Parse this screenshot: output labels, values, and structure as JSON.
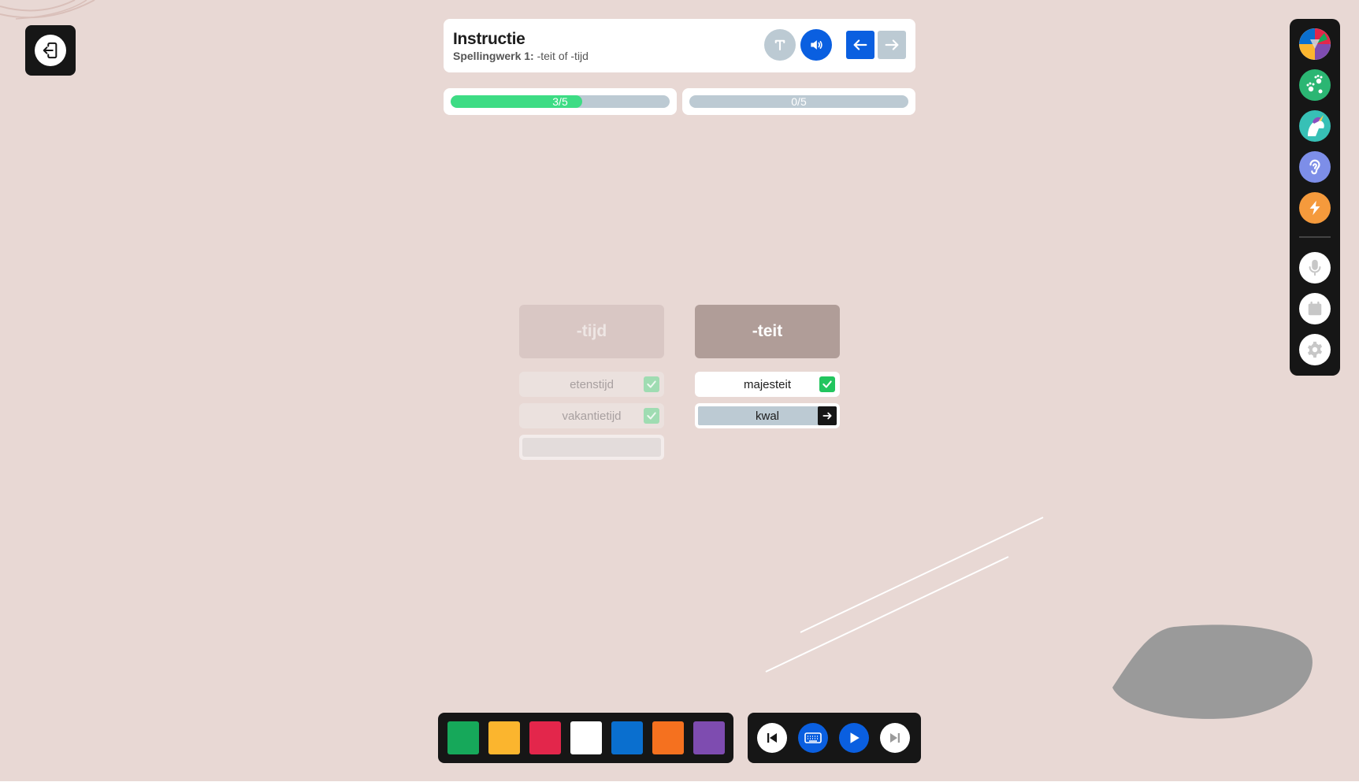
{
  "header": {
    "title": "Instructie",
    "subtitle_bold": "Spellingwerk 1:",
    "subtitle_rest": " -teit of -tijd"
  },
  "progress": [
    {
      "label": "3/5",
      "fraction": 0.6
    },
    {
      "label": "0/5",
      "fraction": 0.0
    }
  ],
  "categories": [
    {
      "label": "-tijd",
      "words": [
        {
          "text": "etenstijd",
          "status": "correct"
        },
        {
          "text": "vakantietijd",
          "status": "correct"
        },
        {
          "text": "",
          "status": "empty"
        }
      ]
    },
    {
      "label": "-teit",
      "words": [
        {
          "text": "majesteit",
          "status": "correct"
        },
        {
          "text": "kwal",
          "status": "active-input"
        }
      ]
    }
  ],
  "sidebar": {
    "items": [
      {
        "icon": "color-wheel-icon"
      },
      {
        "icon": "paw-prints-icon"
      },
      {
        "icon": "unicorn-icon"
      },
      {
        "icon": "ear-icon"
      },
      {
        "icon": "lightning-icon"
      },
      {
        "icon": "microphone-icon"
      },
      {
        "icon": "calendar-icon"
      },
      {
        "icon": "gear-icon"
      }
    ]
  },
  "palette": {
    "colors": [
      "#16a85a",
      "#fbb52e",
      "#e3264b",
      "#ffffff",
      "#0a6fcf",
      "#f5711f",
      "#7e4cb0"
    ]
  },
  "colors": {
    "accent_blue": "#0a5fe0",
    "progress_green": "#3ddc84",
    "check_green": "#22c55e",
    "dark": "#161616"
  }
}
